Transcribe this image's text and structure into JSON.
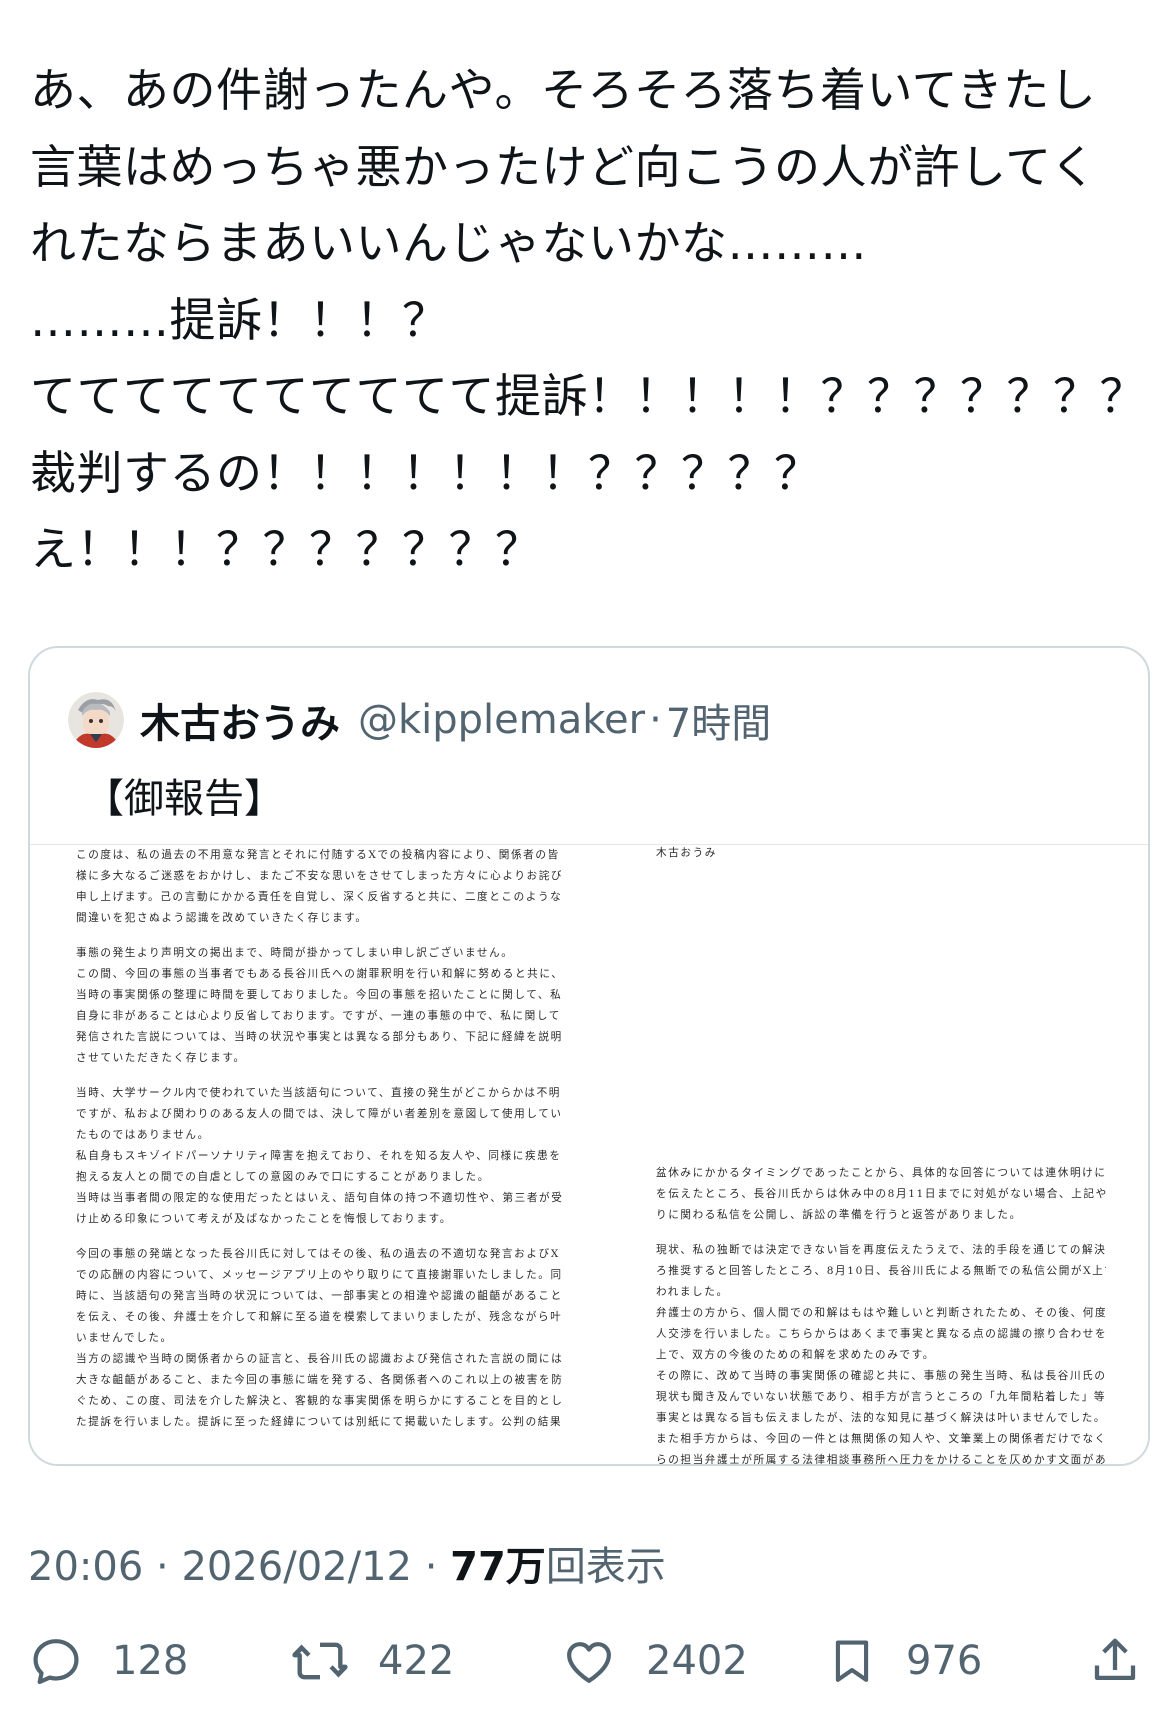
{
  "tweet": {
    "lines": [
      "あ、あの件謝ったんや。そろそろ落ち着いてきたし",
      "言葉はめっちゃ悪かったけど向こうの人が許してく",
      "れたならまあいいんじゃないかな………",
      "………提訴！！！？",
      "てててててててててて提訴！！！！！？？？？？？？",
      "裁判するの！！！！！！！？？？？？",
      "え！！！？？？？？？？"
    ]
  },
  "quote": {
    "display_name": "木古おうみ",
    "handle": "@kipplemaker",
    "separator": "·",
    "time": "7時間",
    "text": "【御報告】",
    "document": {
      "left_paragraphs": [
        [
          "この度は、私の過去の不用意な発言とそれに付随するXでの投稿内容により、関係者の皆",
          "様に多大なるご迷惑をおかけし、またご不安な思いをさせてしまった方々に心よりお詫び",
          "申し上げます。己の言動にかかる責任を自覚し、深く反省すると共に、二度とこのような",
          "間違いを犯さぬよう認識を改めていきたく存じます。"
        ],
        [
          "事態の発生より声明文の掲出まで、時間が掛かってしまい申し訳ございません。",
          "この間、今回の事態の当事者でもある長谷川氏への謝罪釈明を行い和解に努めると共に、",
          "当時の事実関係の整理に時間を要しておりました。今回の事態を招いたことに関して、私",
          "自身に非があることは心より反省しております。ですが、一連の事態の中で、私に関して",
          "発信された言説については、当時の状況や事実とは異なる部分もあり、下記に経緯を説明",
          "させていただきたく存じます。"
        ],
        [
          "当時、大学サークル内で使われていた当該語句について、直接の発生がどこからかは不明",
          "ですが、私および関わりのある友人の間では、決して障がい者差別を意図して使用してい",
          "たものではありません。",
          "私自身もスキゾイドパーソナリティ障害を抱えており、それを知る友人や、同様に疾患を",
          "抱える友人との間での自虐としての意図のみで口にすることがありました。",
          "当時は当事者間の限定的な使用だったとはいえ、語句自体の持つ不適切性や、第三者が受",
          "け止める印象について考えが及ばなかったことを悔恨しております。"
        ],
        [
          "今回の事態の発端となった長谷川氏に対してはその後、私の過去の不適切な発言およびX",
          "での応酬の内容について、メッセージアプリ上のやり取りにて直接謝罪いたしました。同",
          "時に、当該語句の発言当時の状況については、一部事実との相違や認識の齟齬があること",
          "を伝え、その後、弁護士を介して和解に至る道を模索してまいりましたが、残念ながら叶",
          "いませんでした。",
          "当方の認識や当時の関係者からの証言と、長谷川氏の認識および発信された言説の間には",
          "大きな齟齬があること、また今回の事態に端を発する、各関係者へのこれ以上の被害を防",
          "ぐため、この度、司法を介した解決と、客観的な事実関係を明らかにすることを目的とし",
          "た提訴を行いました。提訴に至った経緯については別紙にて掲載いたします。公判の結果"
        ]
      ],
      "right_name": "木古おうみ",
      "right_paragraphs": [
        [
          "盆休みにかかるタイミングであったことから、具体的な回答については連休明けになる旨",
          "を伝えたところ、長谷川氏からは休み中の8月11日までに対処がない場合、上記やり取",
          "りに関わる私信を公開し、訴訟の準備を行うと返答がありました。"
        ],
        [
          "現状、私の独断では決定できない旨を再度伝えたうえで、法的手段を通じての解決はむし",
          "ろ推奨すると回答したところ、8月10日、長谷川氏による無断での私信公開がX上で行",
          "われました。",
          "弁護士の方から、個人間での和解はもはや難しいと判断されたため、その後、何度か代理",
          "人交渉を行いました。こちらからはあくまで事実と異なる点の認識の擦り合わせを行った",
          "上で、双方の今後のための和解を求めたのみです。",
          "その際に、改めて当時の事実関係の確認と共に、事態の発生当時、私は長谷川氏の職業も",
          "現状も聞き及んでいない状態であり、相手方が言うところの「九年間粘着した」等は全く",
          "事実とは異なる旨も伝えましたが、法的な知見に基づく解決は叶いませんでした。",
          "また相手方からは、今回の一件とは無関係の知人や、文筆業上の関係者だけでなく、こち",
          "らの担当弁護士が所属する法律相談事務所へ圧力をかけることを仄めかす文面がありまし"
        ]
      ]
    }
  },
  "meta": {
    "time": "20:06",
    "sep1": " · ",
    "date": "2026/02/12",
    "sep2": " · ",
    "views_count": "77万",
    "views_label": "回表示"
  },
  "actions": {
    "replies": "128",
    "reposts": "422",
    "likes": "2402",
    "bookmarks": "976"
  },
  "colors": {
    "text": "#0f1419",
    "secondary": "#536471",
    "border": "#cfd9de"
  }
}
